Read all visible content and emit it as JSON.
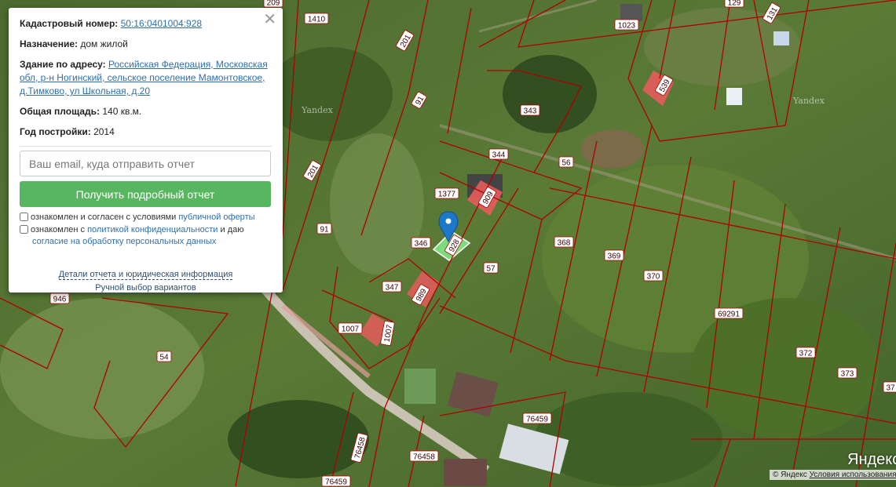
{
  "map": {
    "parcel_labels": [
      "1410",
      "201",
      "91",
      "209",
      "201",
      "91",
      "946",
      "54",
      "1023",
      "129",
      "131",
      "539",
      "343",
      "344",
      "56",
      "1377",
      "909",
      "346",
      "928",
      "347",
      "989",
      "1007",
      "1007",
      "57",
      "368",
      "369",
      "370",
      "69291",
      "372",
      "373",
      "76459",
      "76458",
      "76458",
      "76459",
      "37"
    ],
    "watermarks": [
      "Yandex",
      "Yandex"
    ],
    "logo": "Яндекс",
    "copyright": "© Яндекс",
    "terms_link": "Условия использования",
    "colors": {
      "parcel_border": "#b00000",
      "highlight": "#e55c5c",
      "selected": "#7cdc7c",
      "pin": "#1e78c8"
    }
  },
  "popup": {
    "close_glyph": "✕",
    "cadastral_label": "Кадастровый номер:",
    "cadastral_value": "50:16:0401004:928",
    "purpose_label": "Назначение:",
    "purpose_value": "дом жилой",
    "address_label": "Здание по адресу:",
    "address_value": "Российская Федерация, Московская обл, р-н Ногинский, сельское поселение Мамонтовское, д.Тимково, ул Школьная, д.20",
    "area_label": "Общая площадь:",
    "area_value": "140 кв.м.",
    "year_label": "Год постройки:",
    "year_value": "2014",
    "email_placeholder": "Ваш email, куда отправить отчет",
    "report_button": "Получить подробный отчет",
    "consent1_text": "ознакомлен и согласен с условиями",
    "consent1_link": "публичной оферты",
    "consent2_text_a": "ознакомлен с",
    "consent2_link_a": "политикой конфиденциальности",
    "consent2_text_b": "и даю",
    "consent2_link_b": "согласие на обработку персональных данных",
    "details_link": "Детали отчета и юридическая информация",
    "manual_link": "Ручной выбор вариантов"
  }
}
